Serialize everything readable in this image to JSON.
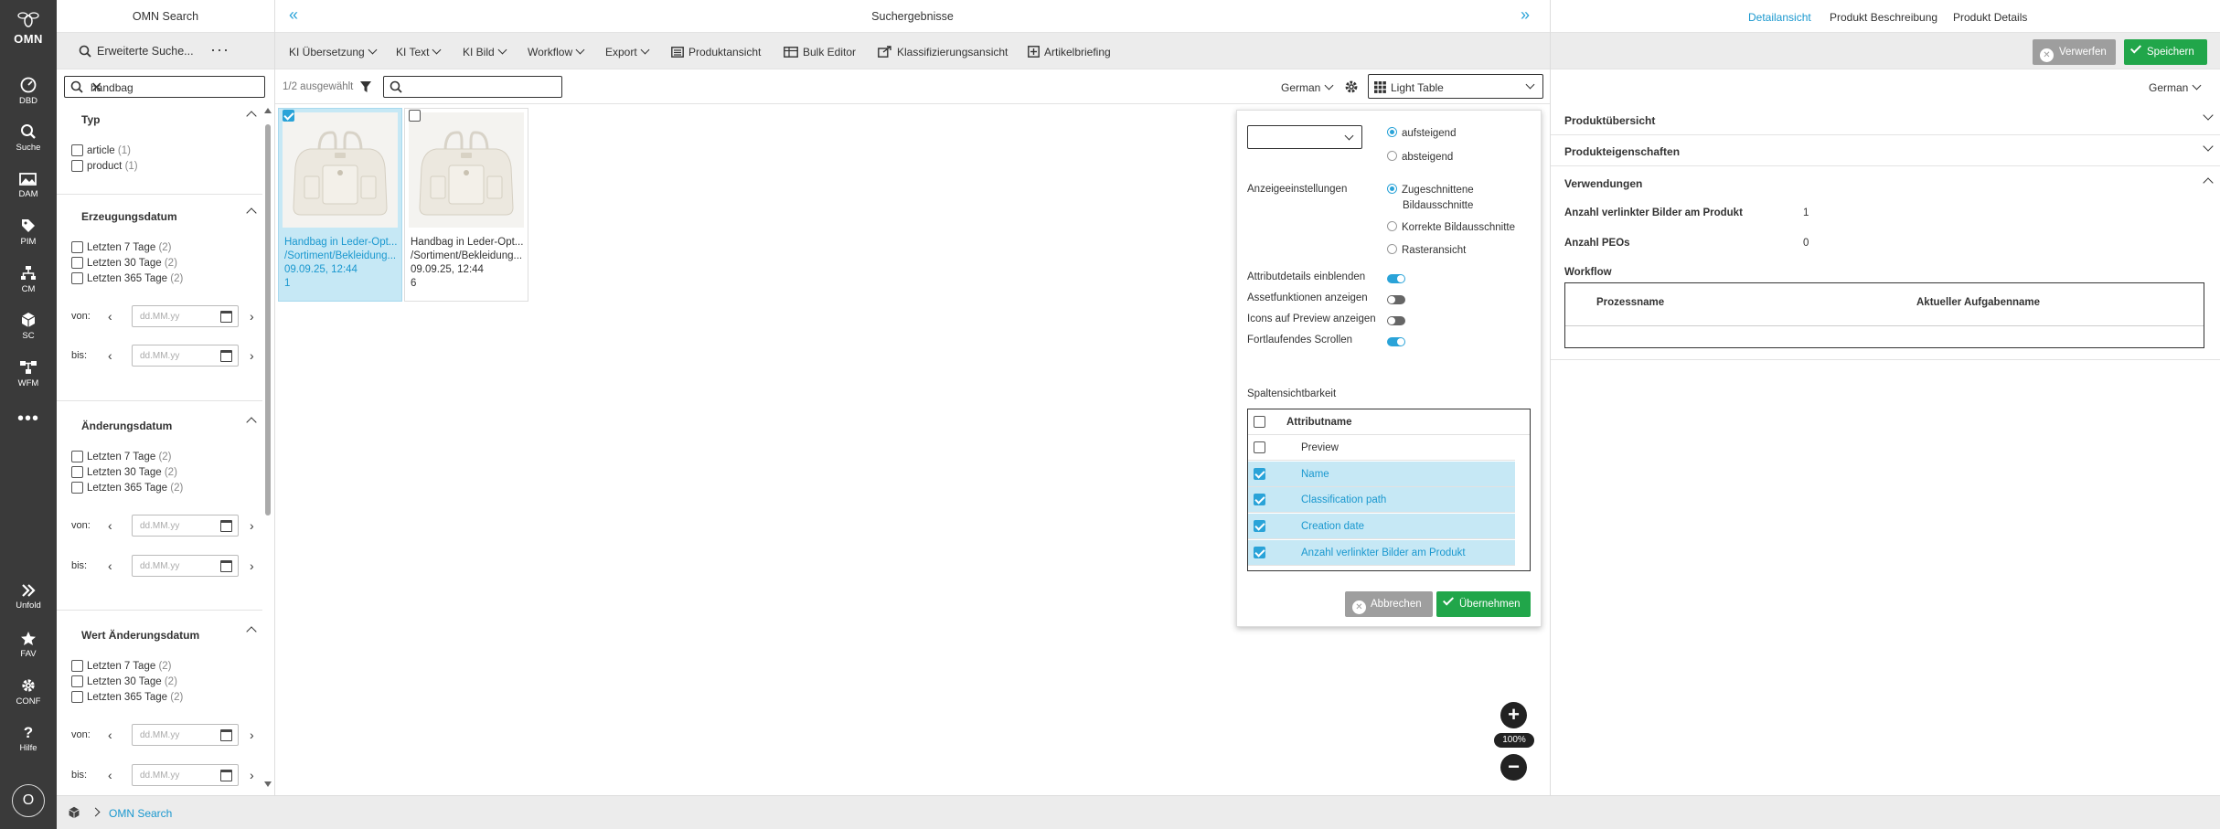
{
  "rail": {
    "logo": "OMN",
    "items": [
      {
        "label": "DBD",
        "icon": "dashboard-icon"
      },
      {
        "label": "Suche",
        "icon": "search-icon"
      },
      {
        "label": "DAM",
        "icon": "image-icon"
      },
      {
        "label": "PIM",
        "icon": "tag-icon"
      },
      {
        "label": "CM",
        "icon": "hierarchy-icon"
      },
      {
        "label": "SC",
        "icon": "cube-icon"
      },
      {
        "label": "WFM",
        "icon": "workflow-icon"
      },
      {
        "label": "Unfold",
        "icon": "double-chevron-icon"
      },
      {
        "label": "FAV",
        "icon": "star-icon"
      },
      {
        "label": "CONF",
        "icon": "gear-icon"
      },
      {
        "label": "Hilfe",
        "icon": "question-icon"
      }
    ],
    "avatar": "O"
  },
  "left_panel": {
    "title": "OMN Search",
    "advanced_search": "Erweiterte Suche...",
    "search_value": "handbag",
    "facets": {
      "typ": {
        "title": "Typ",
        "items": [
          {
            "label": "article",
            "count": "(1)"
          },
          {
            "label": "product",
            "count": "(1)"
          }
        ]
      },
      "erzeugungsdatum": {
        "title": "Erzeugungsdatum",
        "items": [
          {
            "label": "Letzten 7 Tage",
            "count": "(2)"
          },
          {
            "label": "Letzten 30 Tage",
            "count": "(2)"
          },
          {
            "label": "Letzten 365 Tage",
            "count": "(2)"
          }
        ]
      },
      "aenderungsdatum": {
        "title": "Änderungsdatum",
        "items": [
          {
            "label": "Letzten 7 Tage",
            "count": "(2)"
          },
          {
            "label": "Letzten 30 Tage",
            "count": "(2)"
          },
          {
            "label": "Letzten 365 Tage",
            "count": "(2)"
          }
        ]
      },
      "wert_aenderungsdatum": {
        "title": "Wert Änderungsdatum",
        "items": [
          {
            "label": "Letzten 7 Tage",
            "count": "(2)"
          },
          {
            "label": "Letzten 30 Tage",
            "count": "(2)"
          },
          {
            "label": "Letzten 365 Tage",
            "count": "(2)"
          }
        ]
      }
    },
    "von_label": "von:",
    "bis_label": "bis:",
    "date_placeholder": "dd.MM.yy"
  },
  "main": {
    "title": "Suchergebnisse",
    "toolbar": {
      "ki_uebersetzung": "KI Übersetzung",
      "ki_text": "KI Text",
      "ki_bild": "KI Bild",
      "workflow": "Workflow",
      "export": "Export",
      "produktansicht": "Produktansicht",
      "bulk_editor": "Bulk Editor",
      "klassifizierungsansicht": "Klassifizierungsansicht",
      "artikelbriefing": "Artikelbriefing"
    },
    "selected_count": "1/2 ausgewählt",
    "language": "German",
    "view_mode": "Light Table",
    "zoom": "100%",
    "cards": [
      {
        "name": "Handbag in Leder-Opt...",
        "path": "/Sortiment/Bekleidung...",
        "date": "09.09.25, 12:44",
        "count": "1",
        "selected": true
      },
      {
        "name": "Handbag in Leder-Opt...",
        "path": "/Sortiment/Bekleidung...",
        "date": "09.09.25, 12:44",
        "count": "6",
        "selected": false
      }
    ]
  },
  "popup": {
    "sort_asc": "aufsteigend",
    "sort_desc": "absteigend",
    "display_label": "Anzeigeeinstellungen",
    "display_opt1_line1": "Zugeschnittene",
    "display_opt1_line2": "Bildausschnitte",
    "display_opt2": "Korrekte Bildausschnitte",
    "display_opt3": "Rasteransicht",
    "toggles": {
      "attr_details": "Attributdetails einblenden",
      "asset_functions": "Assetfunktionen anzeigen",
      "icons_preview": "Icons auf Preview anzeigen",
      "continuous_scroll": "Fortlaufendes Scrollen"
    },
    "column_visibility": "Spaltensichtbarkeit",
    "col_header": "Attributname",
    "columns": [
      {
        "label": "Preview",
        "checked": false
      },
      {
        "label": "Name",
        "checked": true
      },
      {
        "label": "Classification path",
        "checked": true
      },
      {
        "label": "Creation date",
        "checked": true
      },
      {
        "label": "Anzahl verlinkter Bilder am Produkt",
        "checked": true
      }
    ],
    "cancel": "Abbrechen",
    "apply": "Übernehmen"
  },
  "right_panel": {
    "tabs": [
      "Detailansicht",
      "Produkt Beschreibung",
      "Produkt Details"
    ],
    "discard": "Verwerfen",
    "save": "Speichern",
    "language": "German",
    "sections": {
      "overview": "Produktübersicht",
      "properties": "Produkteigenschaften",
      "usages": "Verwendungen"
    },
    "linked_images_label": "Anzahl verlinkter Bilder am Produkt",
    "linked_images_value": "1",
    "peos_label": "Anzahl PEOs",
    "peos_value": "0",
    "workflow_label": "Workflow",
    "wf_col1": "Prozessname",
    "wf_col2": "Aktueller Aufgabenname"
  },
  "footer": {
    "breadcrumb": "OMN Search"
  },
  "colors": {
    "accent": "#2aa3d8",
    "green": "#21a64a",
    "rail": "#3a3a3a"
  }
}
